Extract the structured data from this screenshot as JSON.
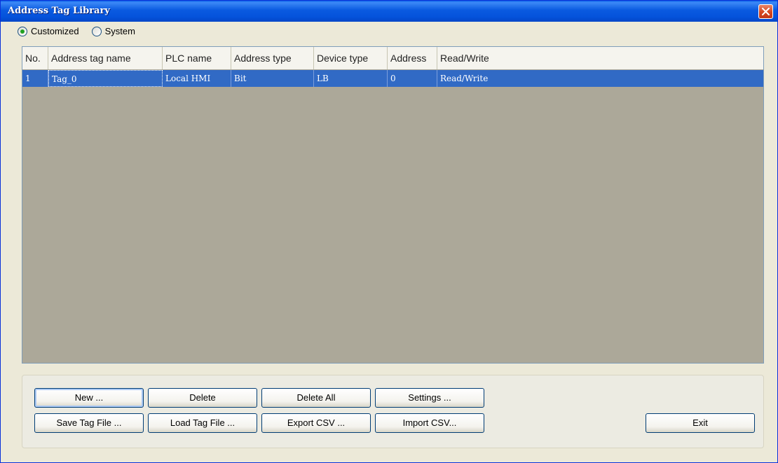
{
  "window": {
    "title": "Address Tag Library"
  },
  "radio": {
    "customized": "Customized",
    "system": "System",
    "selected": "customized"
  },
  "table": {
    "columns": [
      "No.",
      "Address tag name",
      "PLC name",
      "Address type",
      "Device type",
      "Address",
      "Read/Write"
    ],
    "rows": [
      {
        "no": "1",
        "tag_name": "Tag_0",
        "plc_name": "Local HMI",
        "address_type": "Bit",
        "device_type": "LB",
        "address": "0",
        "read_write": "Read/Write"
      }
    ]
  },
  "buttons": {
    "new": "New ...",
    "delete": "Delete",
    "delete_all": "Delete All",
    "settings": "Settings ...",
    "save_tag_file": "Save Tag File ...",
    "load_tag_file": "Load Tag File ...",
    "export_csv": "Export CSV ...",
    "import_csv": "Import CSV...",
    "exit": "Exit"
  },
  "colors": {
    "title_bar": "#0553dc",
    "selection": "#316ac5",
    "table_background": "#aca899",
    "window_background": "#ece9d8"
  },
  "icons": {
    "close": "close-icon"
  }
}
